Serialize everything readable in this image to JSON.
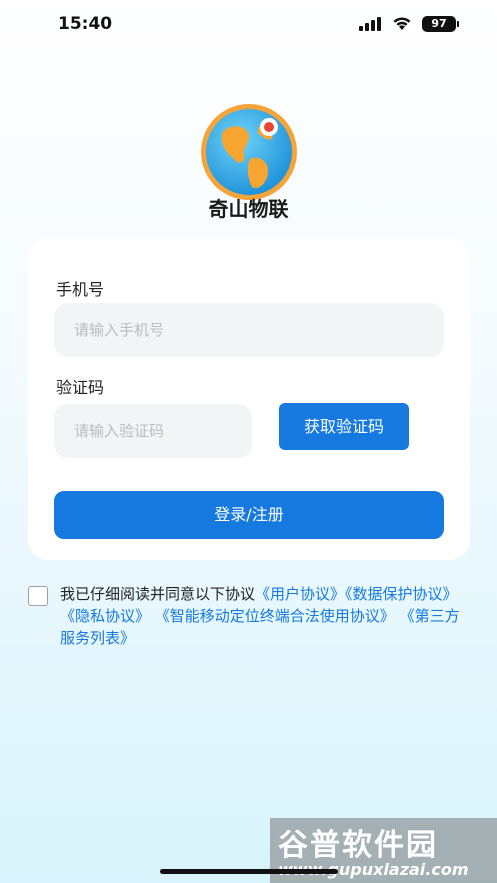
{
  "status_bar": {
    "time": "15:40",
    "battery": "97"
  },
  "app": {
    "name": "奇山物联",
    "logo_icon": "globe-icon"
  },
  "form": {
    "phone_label": "手机号",
    "phone_placeholder": "请输入手机号",
    "phone_value": "",
    "code_label": "验证码",
    "code_placeholder": "请输入验证码",
    "code_value": "",
    "get_code_button": "获取验证码",
    "login_button": "登录/注册"
  },
  "agreement": {
    "checked": false,
    "prefix": "我已仔细阅读并同意以下协议",
    "links": [
      "《用户协议》",
      "《数据保护协议》",
      "《隐私协议》",
      "《智能移动定位终端合法使用协议》",
      "《第三方服务列表》"
    ]
  },
  "watermark": {
    "title": "谷普软件园",
    "url": "www.gupuxlazai.com"
  },
  "colors": {
    "accent": "#1579e0",
    "card": "#ffffff",
    "input_bg": "#f3f4f6"
  }
}
